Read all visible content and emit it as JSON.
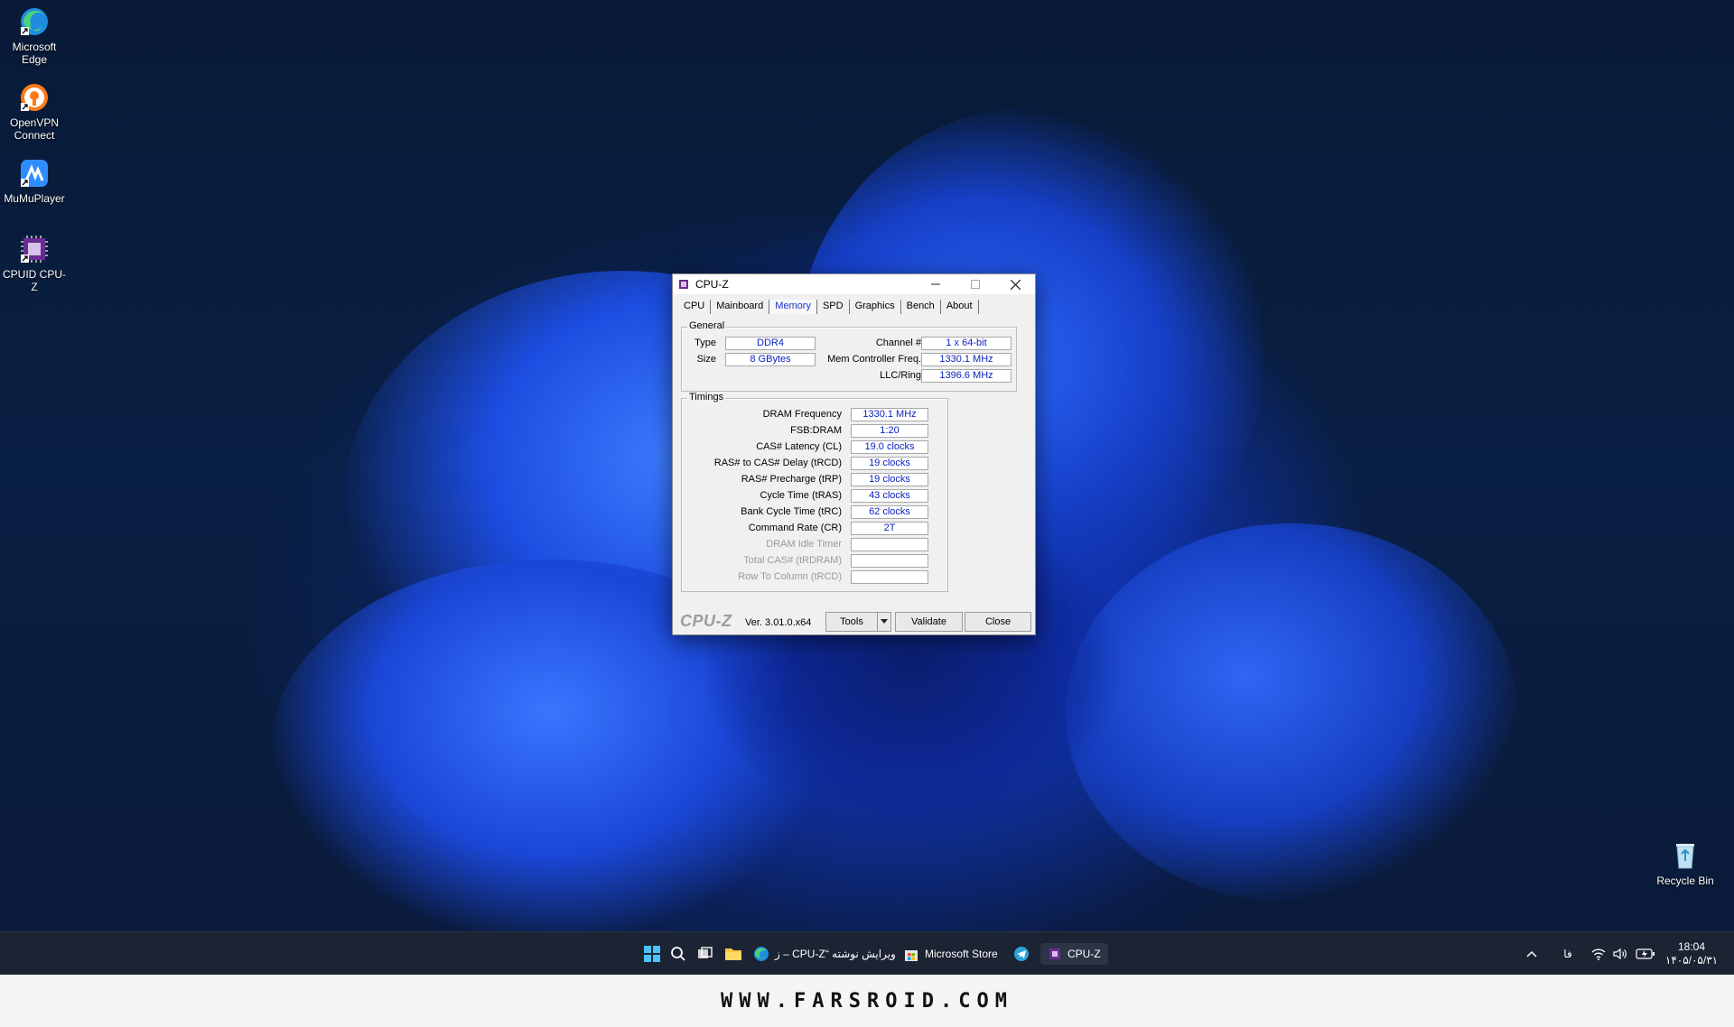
{
  "desktop": {
    "icons": [
      {
        "label": "Microsoft Edge",
        "icon": "edge-icon"
      },
      {
        "label": "OpenVPN Connect",
        "icon": "openvpn-icon"
      },
      {
        "label": "MuMuPlayer",
        "icon": "mumu-icon"
      },
      {
        "label": "CPUID CPU-Z",
        "icon": "cpuz-icon"
      }
    ],
    "recycle_bin": {
      "label": "Recycle Bin",
      "icon": "recycle-bin-icon"
    }
  },
  "window": {
    "title": "CPU-Z",
    "tabs": [
      "CPU",
      "Mainboard",
      "Memory",
      "SPD",
      "Graphics",
      "Bench",
      "About"
    ],
    "active_tab": "Memory",
    "general": {
      "legend": "General",
      "type_label": "Type",
      "type_value": "DDR4",
      "size_label": "Size",
      "size_value": "8 GBytes",
      "channel_label": "Channel #",
      "channel_value": "1 x 64-bit",
      "mcf_label": "Mem Controller Freq.",
      "mcf_value": "1330.1 MHz",
      "llc_label": "LLC/Ring",
      "llc_value": "1396.6 MHz"
    },
    "timings": {
      "legend": "Timings",
      "rows": [
        {
          "label": "DRAM Frequency",
          "value": "1330.1 MHz"
        },
        {
          "label": "FSB:DRAM",
          "value": "1:20"
        },
        {
          "label": "CAS# Latency (CL)",
          "value": "19.0 clocks"
        },
        {
          "label": "RAS# to CAS# Delay (tRCD)",
          "value": "19 clocks"
        },
        {
          "label": "RAS# Precharge (tRP)",
          "value": "19 clocks"
        },
        {
          "label": "Cycle Time (tRAS)",
          "value": "43 clocks"
        },
        {
          "label": "Bank Cycle Time (tRC)",
          "value": "62 clocks"
        },
        {
          "label": "Command Rate (CR)",
          "value": "2T"
        },
        {
          "label": "DRAM Idle Timer",
          "value": ""
        },
        {
          "label": "Total CAS# (tRDRAM)",
          "value": ""
        },
        {
          "label": "Row To Column (tRCD)",
          "value": ""
        }
      ]
    },
    "footer": {
      "logo": "CPU-Z",
      "version": "Ver. 3.01.0.x64",
      "tools_label": "Tools",
      "validate_label": "Validate",
      "close_label": "Close"
    }
  },
  "taskbar": {
    "items": [
      {
        "label": "ویرایش نوشته “CPU-Z – ز",
        "icon": "edge-icon"
      },
      {
        "label": "Microsoft Store",
        "icon": "store-icon"
      },
      {
        "label": "CPU-Z",
        "icon": "cpuz-icon"
      }
    ],
    "language": "فا",
    "time": "18:04",
    "date": "۱۴۰۵/۰۵/۳۱"
  },
  "banner": "WWW.FARSROID.COM"
}
